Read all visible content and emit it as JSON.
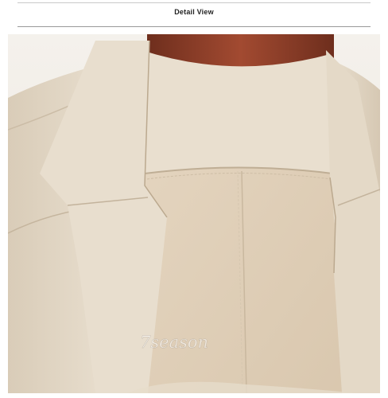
{
  "header": {
    "title": "Detail View"
  },
  "photo": {
    "subject": "beige-coat-collar-detail",
    "watermark": "7season",
    "colors": {
      "fabric": "#e6dccb",
      "fabric_shadow": "#d3c5b0",
      "lining": "#dccbb4",
      "hanger": "#8a3f2a"
    }
  }
}
